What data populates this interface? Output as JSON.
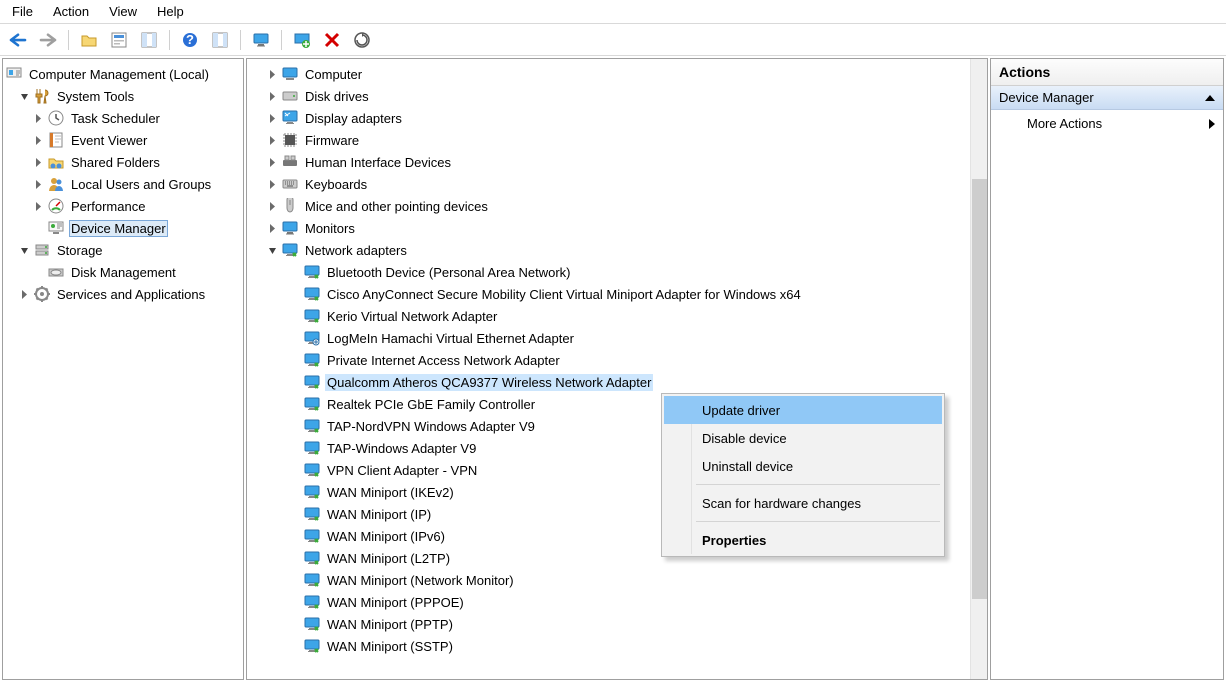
{
  "menu": {
    "file": "File",
    "action": "Action",
    "view": "View",
    "help": "Help"
  },
  "left_tree": {
    "root": "Computer Management (Local)",
    "systools": "System Tools",
    "task_sched": "Task Scheduler",
    "event_viewer": "Event Viewer",
    "shared_folders": "Shared Folders",
    "local_users": "Local Users and Groups",
    "performance": "Performance",
    "device_manager": "Device Manager",
    "storage": "Storage",
    "disk_mgmt": "Disk Management",
    "services": "Services and Applications"
  },
  "mid_tree": {
    "computer": "Computer",
    "disk_drives": "Disk drives",
    "display_adapters": "Display adapters",
    "firmware": "Firmware",
    "hid": "Human Interface Devices",
    "keyboards": "Keyboards",
    "mice": "Mice and other pointing devices",
    "monitors": "Monitors",
    "network_adapters": "Network adapters",
    "na": {
      "bt": "Bluetooth Device (Personal Area Network)",
      "cisco": "Cisco AnyConnect Secure Mobility Client Virtual Miniport Adapter for Windows x64",
      "kerio": "Kerio Virtual Network Adapter",
      "logmein": "LogMeIn Hamachi Virtual Ethernet Adapter",
      "pia": "Private Internet Access Network Adapter",
      "atheros": "Qualcomm Atheros QCA9377 Wireless Network Adapter",
      "realtek": "Realtek PCIe GbE Family Controller",
      "tapnord": "TAP-NordVPN Windows Adapter V9",
      "tapwin": "TAP-Windows Adapter V9",
      "vpncli": "VPN Client Adapter - VPN",
      "wanike": "WAN Miniport (IKEv2)",
      "wanip": "WAN Miniport (IP)",
      "wanip6": "WAN Miniport (IPv6)",
      "wanl2tp": "WAN Miniport (L2TP)",
      "wannm": "WAN Miniport (Network Monitor)",
      "wanpppoe": "WAN Miniport (PPPOE)",
      "wanpptp": "WAN Miniport (PPTP)",
      "wansstp": "WAN Miniport (SSTP)"
    }
  },
  "ctx": {
    "update": "Update driver",
    "disable": "Disable device",
    "uninstall": "Uninstall device",
    "scan": "Scan for hardware changes",
    "props": "Properties"
  },
  "actions": {
    "title": "Actions",
    "heading": "Device Manager",
    "more": "More Actions"
  }
}
